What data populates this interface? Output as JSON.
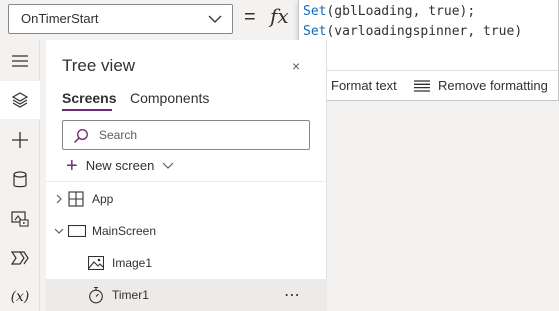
{
  "formula_bar": {
    "property": "OnTimerStart",
    "equals": "=",
    "fx": "fx",
    "lines": [
      {
        "fn": "Set",
        "args": "(gblLoading, true);"
      },
      {
        "fn": "Set",
        "args": "(varloadingspinner, true)"
      }
    ],
    "format_text": "Format text",
    "remove_formatting": "Remove formatting"
  },
  "rail": {
    "icons": [
      "hamburger-icon",
      "layers-icon",
      "plus-icon",
      "database-icon",
      "media-icon",
      "flow-icon",
      "variables-icon"
    ],
    "variables_label": "(x)"
  },
  "tree": {
    "title": "Tree view",
    "close": "×",
    "tabs": [
      "Screens",
      "Components"
    ],
    "search_placeholder": "Search",
    "new_screen": "New screen",
    "items": [
      {
        "label": "App"
      },
      {
        "label": "MainScreen"
      },
      {
        "label": "Image1"
      },
      {
        "label": "Timer1"
      }
    ],
    "more": "⋯"
  },
  "colors": {
    "accent": "#742774",
    "function_blue": "#0f6cbd"
  }
}
